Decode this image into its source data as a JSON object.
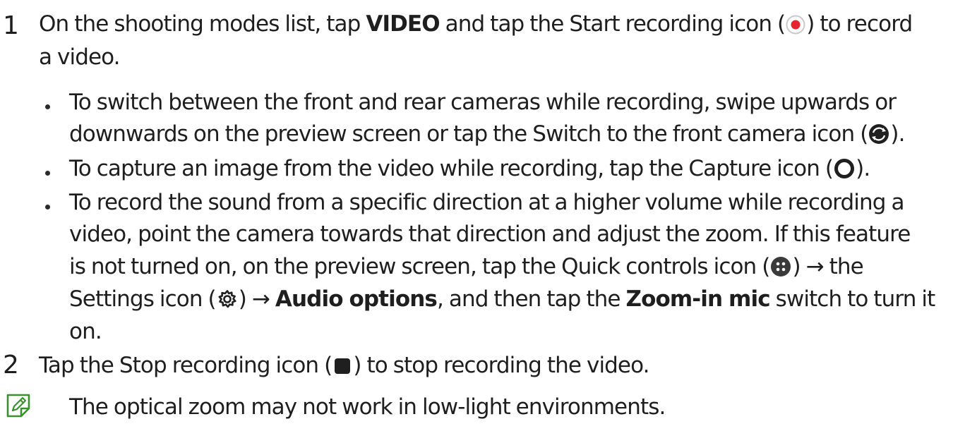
{
  "steps": [
    {
      "number": "1",
      "line1_a": "On the shooting modes list, tap ",
      "line1_bold": "VIDEO",
      "line1_b": " and tap the Start recording icon (",
      "line1_c": ") to record",
      "line2": "a video.",
      "bullets": [
        {
          "line1": "To switch between the front and rear cameras while recording, swipe upwards or",
          "line2_a": "downwards on the preview screen or tap the Switch to the front camera icon (",
          "line2_b": ")."
        },
        {
          "line1_a": "To capture an image from the video while recording, tap the Capture icon (",
          "line1_b": ")."
        },
        {
          "line1": "To record the sound from a specific direction at a higher volume while recording a",
          "line2": "video, point the camera towards that direction and adjust the zoom. If this feature",
          "line3_a": "is not turned on, on the preview screen, tap the Quick controls icon (",
          "line3_b": ") → the",
          "line4_a": "Settings icon (",
          "line4_b": ") → ",
          "line4_bold1": "Audio options",
          "line4_c": ", and then tap the ",
          "line4_bold2": "Zoom-in mic",
          "line4_d": " switch to turn it",
          "line5": "on."
        }
      ]
    },
    {
      "number": "2",
      "line1_a": "Tap the Stop recording icon (",
      "line1_b": ") to stop recording the video."
    }
  ],
  "note": {
    "text": "The optical zoom may not work in low-light environments.",
    "icon": "note-icon"
  },
  "icons": {
    "start_recording": "record-icon",
    "switch_camera": "switch-camera-icon",
    "capture": "capture-icon",
    "quick_controls": "quick-controls-icon",
    "settings": "settings-icon",
    "stop_recording": "stop-icon"
  },
  "colors": {
    "record_red": "#e2262d",
    "note_green": "#3a8f2e",
    "text": "#1e1e1e"
  }
}
